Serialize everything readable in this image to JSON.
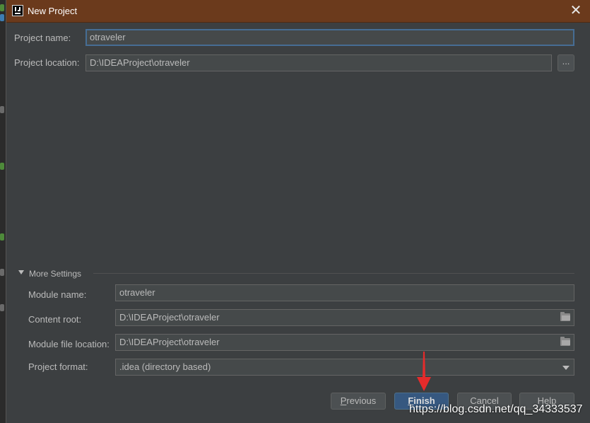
{
  "window": {
    "title": "New Project",
    "close_icon": "close-icon",
    "app_icon": "intellij-idea-icon"
  },
  "form": {
    "project_name_label": "Project name:",
    "project_name_value": "otraveler",
    "project_location_label": "Project location:",
    "project_location_value": "D:\\IDEAProject\\otraveler",
    "browse_label": "..."
  },
  "more_settings": {
    "label": "More Settings",
    "module_name_label": "Module name:",
    "module_name_value": "otraveler",
    "content_root_label": "Content root:",
    "content_root_value": "D:\\IDEAProject\\otraveler",
    "module_file_location_label": "Module file location:",
    "module_file_location_value": "D:\\IDEAProject\\otraveler",
    "project_format_label": "Project format:",
    "project_format_value": ".idea (directory based)"
  },
  "buttons": {
    "previous_u": "P",
    "previous_rest": "revious",
    "finish_u": "F",
    "finish_rest": "inish",
    "cancel": "Cancel",
    "help": "Help"
  },
  "watermark": "https://blog.csdn.net/qq_34333537",
  "colors": {
    "titlebar": "#6b3a1c",
    "dialog_bg": "#3c3f41",
    "focus_border": "#466d94",
    "default_button": "#365880",
    "annotation_arrow": "#e52b2b"
  }
}
